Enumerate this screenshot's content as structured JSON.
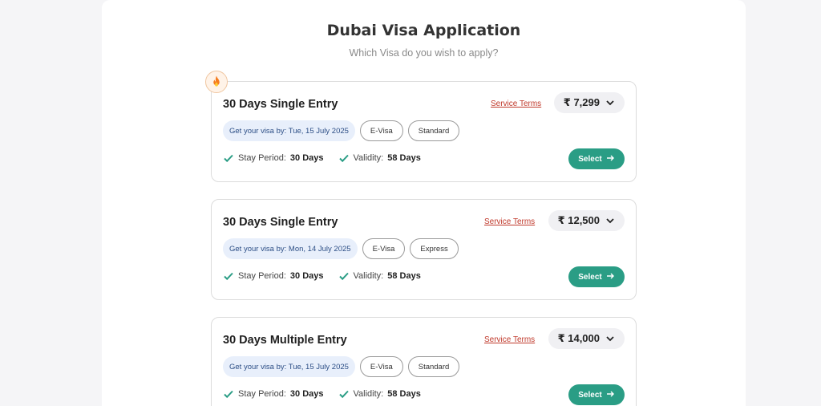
{
  "header": {
    "title": "Dubai Visa Application",
    "subtitle": "Which Visa do you wish to apply?"
  },
  "colors": {
    "accent": "#2a9d85",
    "terms_link": "#c0392b",
    "delivery_bg": "#e8effb"
  },
  "cards": [
    {
      "badge_icon": "fire-icon",
      "title": "30 Days Single Entry",
      "terms_label": "Service Terms",
      "price": "₹ 7,299",
      "delivery": "Get your visa by: Tue, 15 July 2025",
      "tags": [
        "E-Visa",
        "Standard"
      ],
      "stay_label": "Stay Period:",
      "stay_value": "30 Days",
      "validity_label": "Validity:",
      "validity_value": "58 Days",
      "select_label": "Select"
    },
    {
      "title": "30 Days Single Entry",
      "terms_label": "Service Terms",
      "price": "₹ 12,500",
      "delivery": "Get your visa by: Mon, 14 July 2025",
      "tags": [
        "E-Visa",
        "Express"
      ],
      "stay_label": "Stay Period:",
      "stay_value": "30 Days",
      "validity_label": "Validity:",
      "validity_value": "58 Days",
      "select_label": "Select"
    },
    {
      "title": "30 Days Multiple Entry",
      "terms_label": "Service Terms",
      "price": "₹ 14,000",
      "delivery": "Get your visa by: Tue, 15 July 2025",
      "tags": [
        "E-Visa",
        "Standard"
      ],
      "stay_label": "Stay Period:",
      "stay_value": "30 Days",
      "validity_label": "Validity:",
      "validity_value": "58 Days",
      "select_label": "Select"
    }
  ]
}
